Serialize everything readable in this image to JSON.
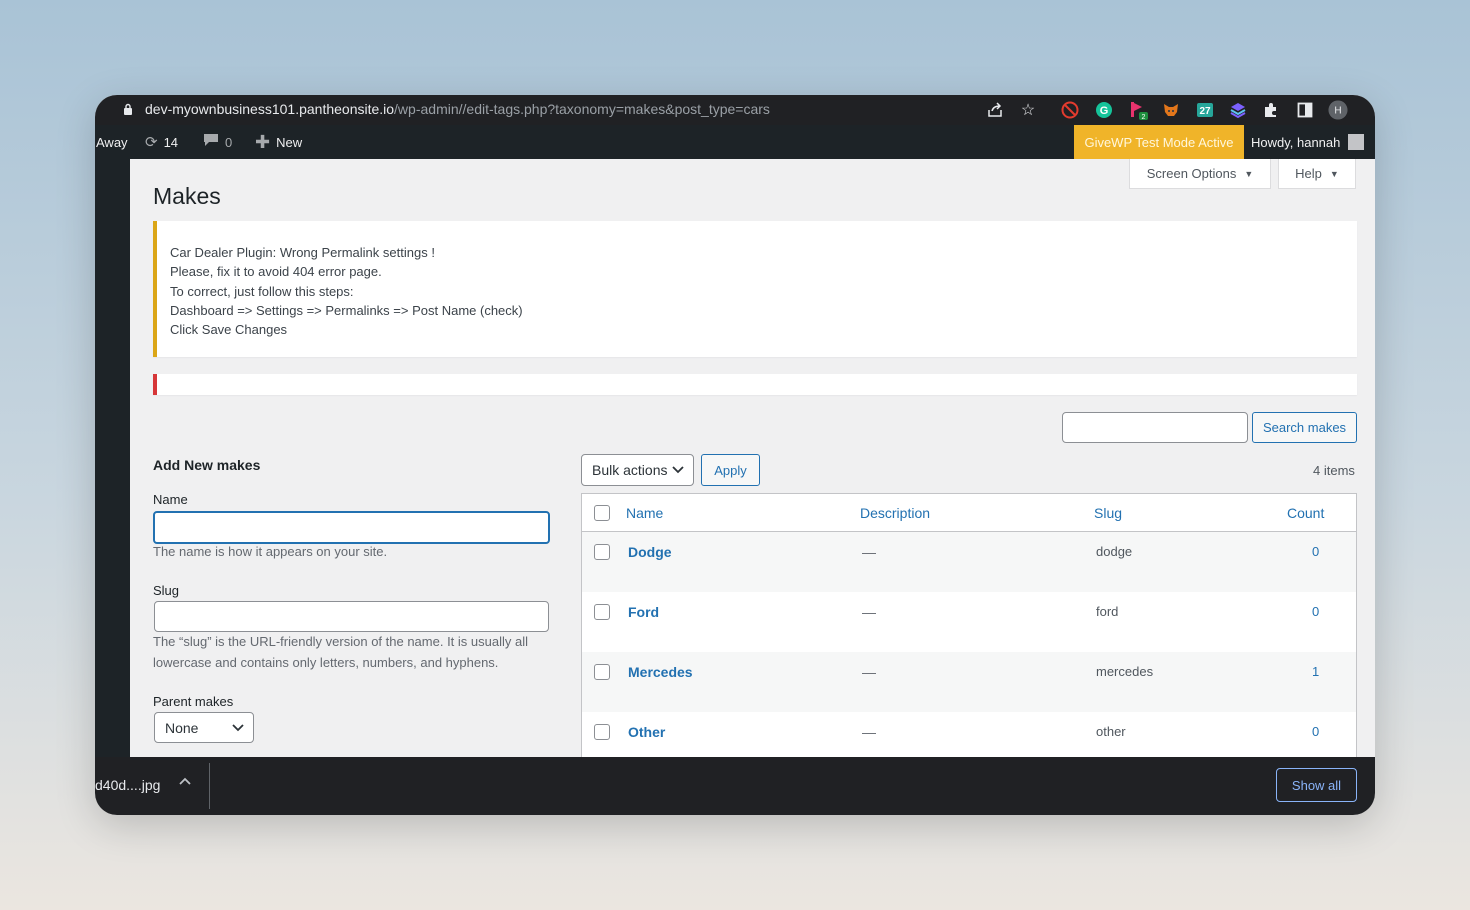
{
  "browser": {
    "url_host": "dev-myownbusiness101.pantheonsite.io",
    "url_path": "/wp-admin//edit-tags.php?taxonomy=makes&post_type=cars",
    "profile_initial": "H",
    "extension_badge": "2",
    "extension_number": "27"
  },
  "adminbar": {
    "site_label": "Away",
    "updates_count": "14",
    "comments_count": "0",
    "new_label": "New",
    "givewp_notice": "GiveWP Test Mode Active",
    "howdy": "Howdy, hannah"
  },
  "screen_options": {
    "label": "Screen Options"
  },
  "help": {
    "label": "Help"
  },
  "page": {
    "title": "Makes"
  },
  "notice": {
    "lines": [
      "Car Dealer Plugin: Wrong Permalink settings !",
      "Please, fix it to avoid 404 error page.",
      "To correct, just follow this steps:",
      "Dashboard => Settings => Permalinks => Post Name (check)",
      "Click Save Changes"
    ]
  },
  "search": {
    "input_value": "",
    "button_label": "Search makes"
  },
  "add_form": {
    "title": "Add New makes",
    "name_label": "Name",
    "name_value": "",
    "name_help": "The name is how it appears on your site.",
    "slug_label": "Slug",
    "slug_value": "",
    "slug_help_line1": "The “slug” is the URL-friendly version of the name. It is usually all",
    "slug_help_line2": "lowercase and contains only letters, numbers, and hyphens.",
    "parent_label": "Parent makes",
    "parent_selected": "None"
  },
  "list": {
    "bulk_selected": "Bulk actions",
    "apply_label": "Apply",
    "items_count": "4 items",
    "columns": {
      "name": "Name",
      "description": "Description",
      "slug": "Slug",
      "count": "Count"
    },
    "rows": [
      {
        "name": "Dodge",
        "description": "—",
        "slug": "dodge",
        "count": "0"
      },
      {
        "name": "Ford",
        "description": "—",
        "slug": "ford",
        "count": "0"
      },
      {
        "name": "Mercedes",
        "description": "—",
        "slug": "mercedes",
        "count": "1"
      },
      {
        "name": "Other",
        "description": "—",
        "slug": "other",
        "count": "0"
      }
    ]
  },
  "downloads": {
    "file_name": "d40d....jpg",
    "show_all_label": "Show all"
  },
  "colors": {
    "givewp": "#f0b429",
    "notice_warning": "#dba617",
    "notice_error": "#d63638",
    "wp_blue": "#2271b1",
    "admin_bar": "#1d2327"
  }
}
